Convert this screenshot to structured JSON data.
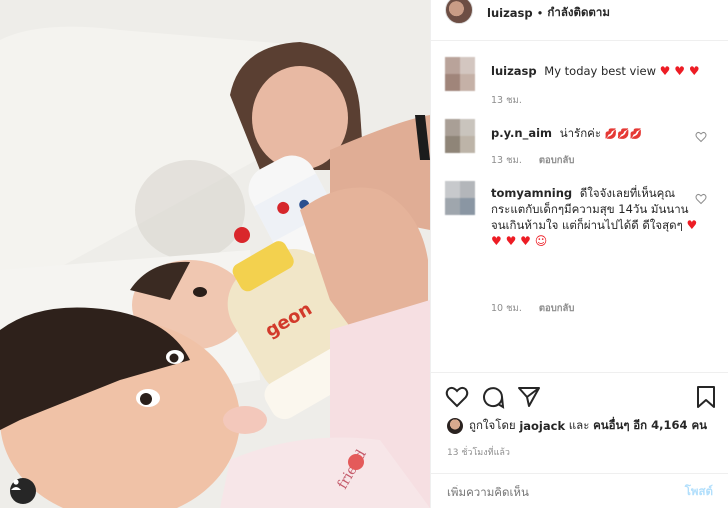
{
  "header": {
    "username": "luizasp",
    "separator": "•",
    "follow_status": "กำลังติดตาม"
  },
  "caption": {
    "username": "luizasp",
    "text": "My today best view",
    "hearts": "♥ ♥ ♥",
    "time": "13 ชม."
  },
  "comments": [
    {
      "username": "p.y.n_aim",
      "text": "น่ารักค่ะ",
      "emoji": "💋💋💋",
      "time": "13 ชม.",
      "reply": "ตอบกลับ"
    },
    {
      "username": "tomyamning",
      "text": "ดีใจจังเลยที่เห็นคุณกระแตกับเด็กๆมีความสุข 14วัน มันนานจนเกินห้ามใจ แต่ก็ผ่านไปได้ดี ดีใจสุดๆ",
      "emoji": "♥ ♥ ♥ ♥ ☺",
      "time": "10 ชม.",
      "reply": "ตอบกลับ"
    }
  ],
  "likes": {
    "prefix": "ถูกใจโดย",
    "user": "jaojack",
    "conj": "และ",
    "others": "คนอื่นๆ",
    "count_text": "อีก 4,164 คน"
  },
  "post_time": "13 ชั่วโมงที่แล้ว",
  "add_comment": {
    "placeholder": "เพิ่มความคิดเห็น",
    "post_label": "โพสต์"
  },
  "colors": {
    "heart_red": "#ed1c24",
    "post_disabled": "#b2dffc",
    "meta_gray": "#8e8e8e"
  }
}
